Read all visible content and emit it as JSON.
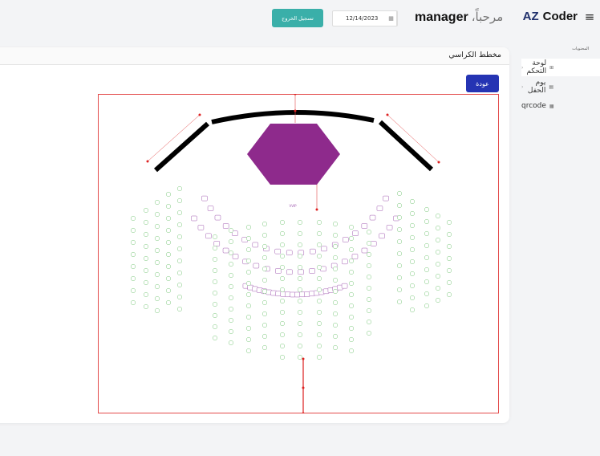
{
  "header": {
    "brand_prefix": "AZ",
    "brand_name": "Coder",
    "menu_icon": "hamburger-icon",
    "welcome_text": "مرحباً،",
    "username": "manager",
    "date_value": "12/14/2023",
    "logout_label": "تسجيل الخروج"
  },
  "sidebar": {
    "section_title": "المحتويات",
    "items": [
      {
        "label": "لوحة التحكم",
        "icon": "grid-icon",
        "active": true
      },
      {
        "label": "يوم الحفل",
        "icon": "calendar-icon",
        "active": false
      },
      {
        "label": "qrcode",
        "icon": "qrcode-icon",
        "active": false
      }
    ]
  },
  "main": {
    "title": "مخطط الكراسي",
    "back_label": "عودة",
    "stage_label": "VVIP"
  },
  "colors": {
    "accent_teal": "#3aafa9",
    "button_blue": "#2534b3",
    "stage_purple": "#8e2a8c",
    "vip_seat": "#a05ab0",
    "regular_seat": "#7ac77a",
    "border_red": "#e34b4b"
  }
}
